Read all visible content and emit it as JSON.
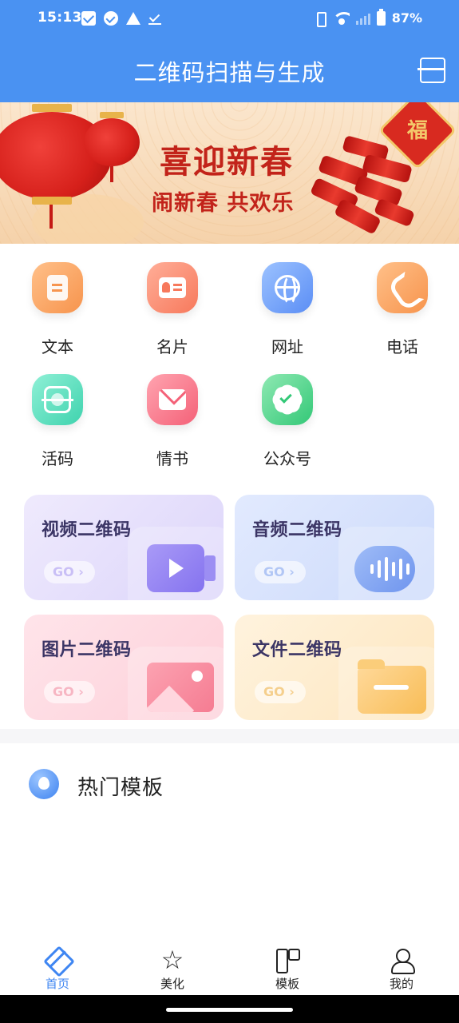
{
  "status_bar": {
    "time": "15:13",
    "battery": "87%"
  },
  "header": {
    "title": "二维码扫描与生成"
  },
  "banner": {
    "headline": "喜迎新春",
    "subline": "闹新春 共欢乐",
    "emblem_text": "福"
  },
  "create_types": [
    {
      "label": "文本",
      "icon": "text-doc-icon",
      "color": "#f7944d"
    },
    {
      "label": "名片",
      "icon": "business-card-icon",
      "color": "#f7795c"
    },
    {
      "label": "网址",
      "icon": "globe-icon",
      "color": "#5b8ef5"
    },
    {
      "label": "电话",
      "icon": "phone-icon",
      "color": "#f7944d"
    },
    {
      "label": "活码",
      "icon": "scan-frame-icon",
      "color": "#3fd3ae"
    },
    {
      "label": "情书",
      "icon": "envelope-icon",
      "color": "#f46178"
    },
    {
      "label": "公众号",
      "icon": "verified-badge-icon",
      "color": "#33c877"
    }
  ],
  "cards": [
    {
      "title": "视频二维码",
      "go": "GO ›",
      "icon": "video-camera-icon"
    },
    {
      "title": "音频二维码",
      "go": "GO ›",
      "icon": "audio-wave-icon"
    },
    {
      "title": "图片二维码",
      "go": "GO ›",
      "icon": "image-icon"
    },
    {
      "title": "文件二维码",
      "go": "GO ›",
      "icon": "folder-icon"
    }
  ],
  "section": {
    "title": "热门模板",
    "icon": "fire-icon"
  },
  "tabbar": {
    "items": [
      {
        "label": "首页",
        "icon": "home-pencil-icon",
        "active": true
      },
      {
        "label": "美化",
        "icon": "star-icon",
        "active": false
      },
      {
        "label": "模板",
        "icon": "template-icon",
        "active": false
      },
      {
        "label": "我的",
        "icon": "user-icon",
        "active": false
      }
    ],
    "active_color": "#3f86f2"
  },
  "colors": {
    "primary": "#4a92f2",
    "banner_text": "#c2231a"
  }
}
